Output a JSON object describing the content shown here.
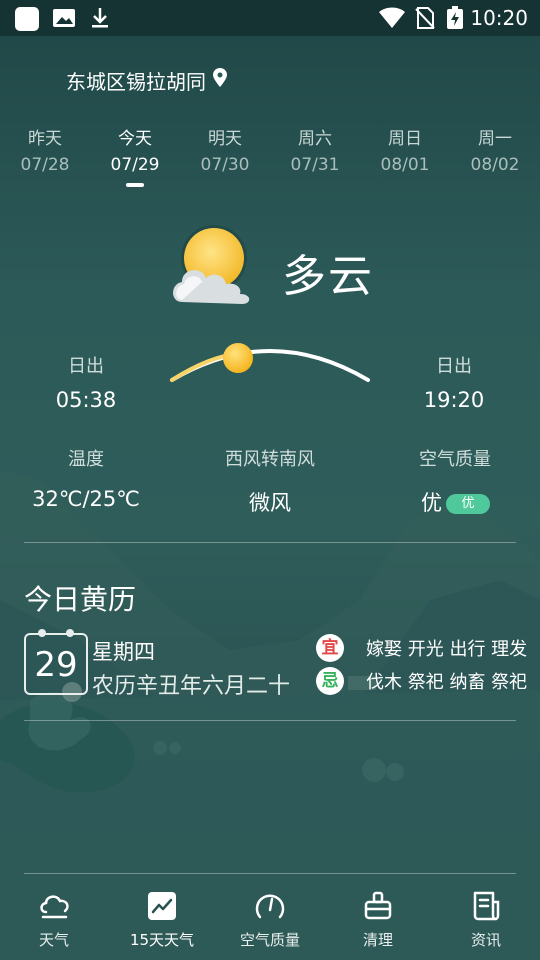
{
  "status_bar": {
    "time": "10:20"
  },
  "location": {
    "name": "东城区锡拉胡同"
  },
  "tabs": [
    {
      "label": "昨天",
      "date": "07/28",
      "active": false
    },
    {
      "label": "今天",
      "date": "07/29",
      "active": true
    },
    {
      "label": "明天",
      "date": "07/30",
      "active": false
    },
    {
      "label": "周六",
      "date": "07/31",
      "active": false
    },
    {
      "label": "周日",
      "date": "08/01",
      "active": false
    },
    {
      "label": "周一",
      "date": "08/02",
      "active": false
    }
  ],
  "weather": {
    "condition": "多云",
    "icon": "partly-cloudy-icon"
  },
  "sun": {
    "sunrise_label": "日出",
    "sunrise_time": "05:38",
    "sunset_label": "日出",
    "sunset_time": "19:20",
    "progress": 0.45
  },
  "metrics": {
    "temperature_label": "温度",
    "temperature_value": "32℃/25℃",
    "wind_label": "西风转南风",
    "wind_value": "微风",
    "aq_label": "空气质量",
    "aq_value": "优",
    "aq_badge": "优",
    "aq_badge_color": "#4fc99b"
  },
  "almanac": {
    "title": "今日黄历",
    "day": "29",
    "weekday": "星期四",
    "lunar": "农历辛丑年六月二十",
    "yi_label": "宜",
    "yi_items": "嫁娶 开光 出行 理发",
    "ji_label": "忌",
    "ji_items": "伐木 祭祀 纳畜 祭祀"
  },
  "bottom_nav": [
    {
      "label": "天气",
      "icon": "cloud-icon"
    },
    {
      "label": "15天天气",
      "icon": "trend-chart-icon"
    },
    {
      "label": "空气质量",
      "icon": "gauge-icon"
    },
    {
      "label": "清理",
      "icon": "broom-icon"
    },
    {
      "label": "资讯",
      "icon": "news-icon"
    }
  ]
}
